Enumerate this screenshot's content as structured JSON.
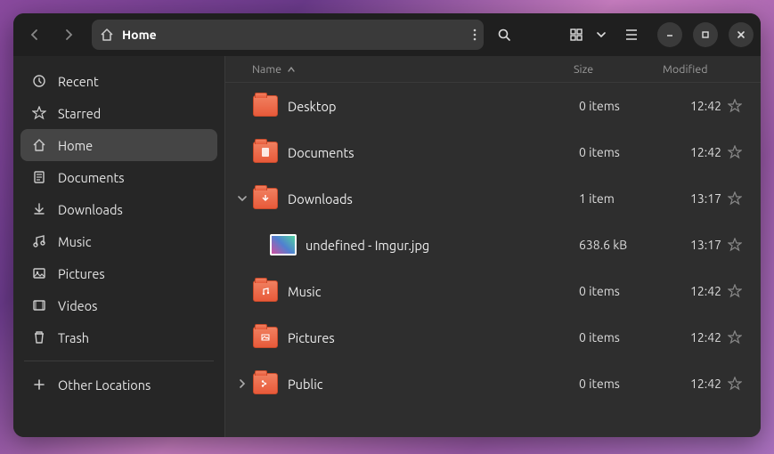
{
  "header": {
    "location_label": "Home"
  },
  "sidebar": {
    "items": [
      {
        "label": "Recent"
      },
      {
        "label": "Starred"
      },
      {
        "label": "Home"
      },
      {
        "label": "Documents"
      },
      {
        "label": "Downloads"
      },
      {
        "label": "Music"
      },
      {
        "label": "Pictures"
      },
      {
        "label": "Videos"
      },
      {
        "label": "Trash"
      }
    ],
    "other_label": "Other Locations"
  },
  "columns": {
    "name": "Name",
    "size": "Size",
    "modified": "Modified"
  },
  "rows": [
    {
      "name": "Desktop",
      "size": "0 items",
      "modified": "12:42"
    },
    {
      "name": "Documents",
      "size": "0 items",
      "modified": "12:42"
    },
    {
      "name": "Downloads",
      "size": "1 item",
      "modified": "13:17"
    },
    {
      "name": "undefined - Imgur.jpg",
      "size": "638.6 kB",
      "modified": "13:17"
    },
    {
      "name": "Music",
      "size": "0 items",
      "modified": "12:42"
    },
    {
      "name": "Pictures",
      "size": "0 items",
      "modified": "12:42"
    },
    {
      "name": "Public",
      "size": "0 items",
      "modified": "12:42"
    }
  ]
}
